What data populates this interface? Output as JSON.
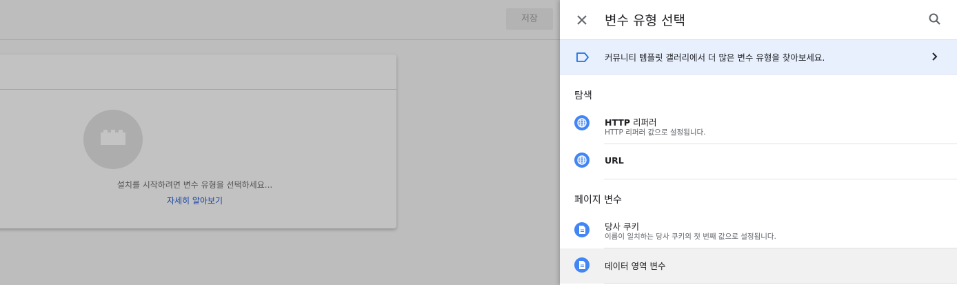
{
  "background": {
    "save_label": "저장",
    "card_message": "설치를 시작하려면 변수 유형을 선택하세요...",
    "card_link": "자세히 알아보기"
  },
  "panel": {
    "title": "변수 유형 선택",
    "banner_text": "커뮤니티 템플릿 갤러리에서 더 많은 변수 유형을 찾아보세요.",
    "sections": [
      {
        "title": "탐색",
        "items": [
          {
            "title_en": "HTTP",
            "title_rest": " 리퍼러",
            "description": "HTTP 리퍼러 값으로 설정됩니다.",
            "icon": "globe-icon"
          },
          {
            "title_en": "URL",
            "title_rest": "",
            "description": "",
            "icon": "globe-icon"
          }
        ]
      },
      {
        "title": "페이지 변수",
        "items": [
          {
            "title_en": "",
            "title_rest": "당사 쿠키",
            "description": "이름이 일치하는 당사 쿠키의 첫 번째 값으로 설정됩니다.",
            "icon": "document-icon"
          },
          {
            "title_en": "",
            "title_rest": "데이터 영역 변수",
            "description": "",
            "icon": "document-icon"
          }
        ]
      }
    ]
  },
  "colors": {
    "accent": "#4285f4",
    "banner_bg": "#e8f0fe",
    "link": "#1c46a2"
  }
}
